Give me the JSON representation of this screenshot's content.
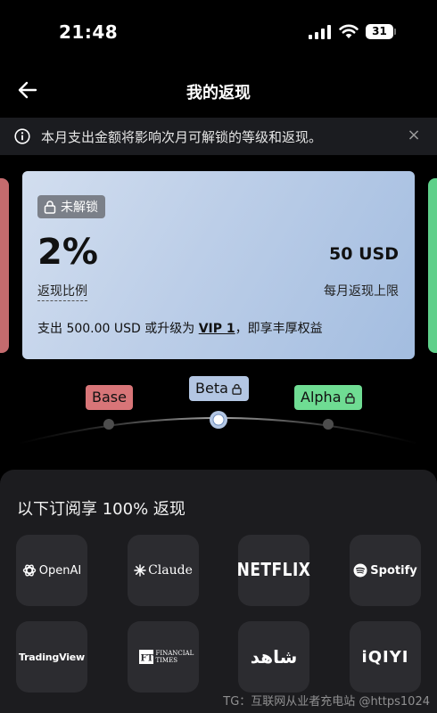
{
  "status_bar": {
    "time": "21:48",
    "battery": "31"
  },
  "header": {
    "title": "我的返现"
  },
  "notice": {
    "text": "本月支出金额将影响次月可解锁的等级和返现。",
    "close": "×"
  },
  "tier_card": {
    "lock_label": "未解锁",
    "rate_value": "2%",
    "rate_label": "返现比例",
    "cap_value": "50 USD",
    "cap_label": "每月返现上限",
    "condition_prefix": "支出 500.00 USD 或升级为 ",
    "condition_link": "VIP 1",
    "condition_suffix": "，即享丰厚权益"
  },
  "tiers": [
    {
      "name": "Base",
      "color": "#d87578",
      "locked": false
    },
    {
      "name": "Beta",
      "color": "#b3c6e3",
      "locked": true,
      "selected": true
    },
    {
      "name": "Alpha",
      "color": "#6fdc93",
      "locked": true
    }
  ],
  "subscriptions": {
    "title": "以下订阅享 100% 返现",
    "services": [
      {
        "label": "OpenAI",
        "icon": "openai-icon"
      },
      {
        "label": "Claude",
        "icon": "claude-icon"
      },
      {
        "label": "NETFLIX",
        "icon": "netflix-logo"
      },
      {
        "label": "Spotify",
        "icon": "spotify-icon"
      },
      {
        "label": "TradingView",
        "icon": "tradingview-logo"
      },
      {
        "label": "FINANCIAL TIMES",
        "icon": "ft-logo"
      },
      {
        "label": "شاهد",
        "icon": "shahid-logo"
      },
      {
        "label": "iQIYI",
        "icon": "iqiyi-logo"
      }
    ]
  },
  "watermark": "TG：互联网从业者充电站 @https1024"
}
